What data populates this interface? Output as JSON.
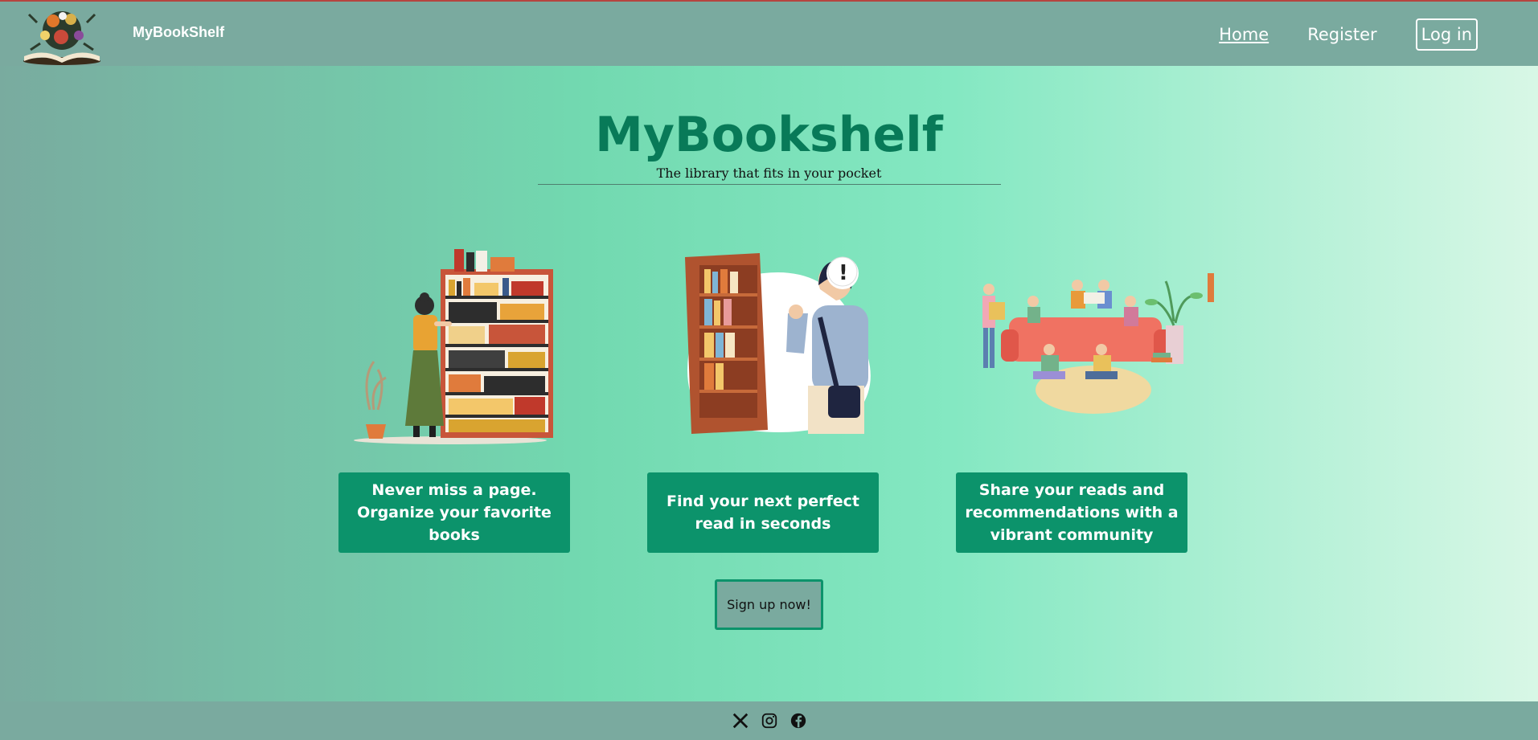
{
  "header": {
    "brand": "MyBookShelf",
    "nav": {
      "home": "Home",
      "register": "Register",
      "login": "Log in"
    }
  },
  "hero": {
    "title": "MyBookshelf",
    "subtitle": "The library that fits in your pocket"
  },
  "features": [
    {
      "text": "Never miss a page. Organize your favorite books",
      "icon": "woman-bookshelf-illustration"
    },
    {
      "text": "Find your next perfect read in seconds",
      "icon": "man-bookcase-illustration"
    },
    {
      "text": "Share your reads and recommendations with a vibrant community",
      "icon": "reading-community-illustration"
    }
  ],
  "cta": {
    "label": "Sign up now!"
  },
  "footer": {
    "icons": [
      "x-icon",
      "instagram-icon",
      "facebook-icon"
    ]
  },
  "colors": {
    "accent": "#0c936b",
    "title": "#087a58",
    "header": "#7aaa9f"
  }
}
